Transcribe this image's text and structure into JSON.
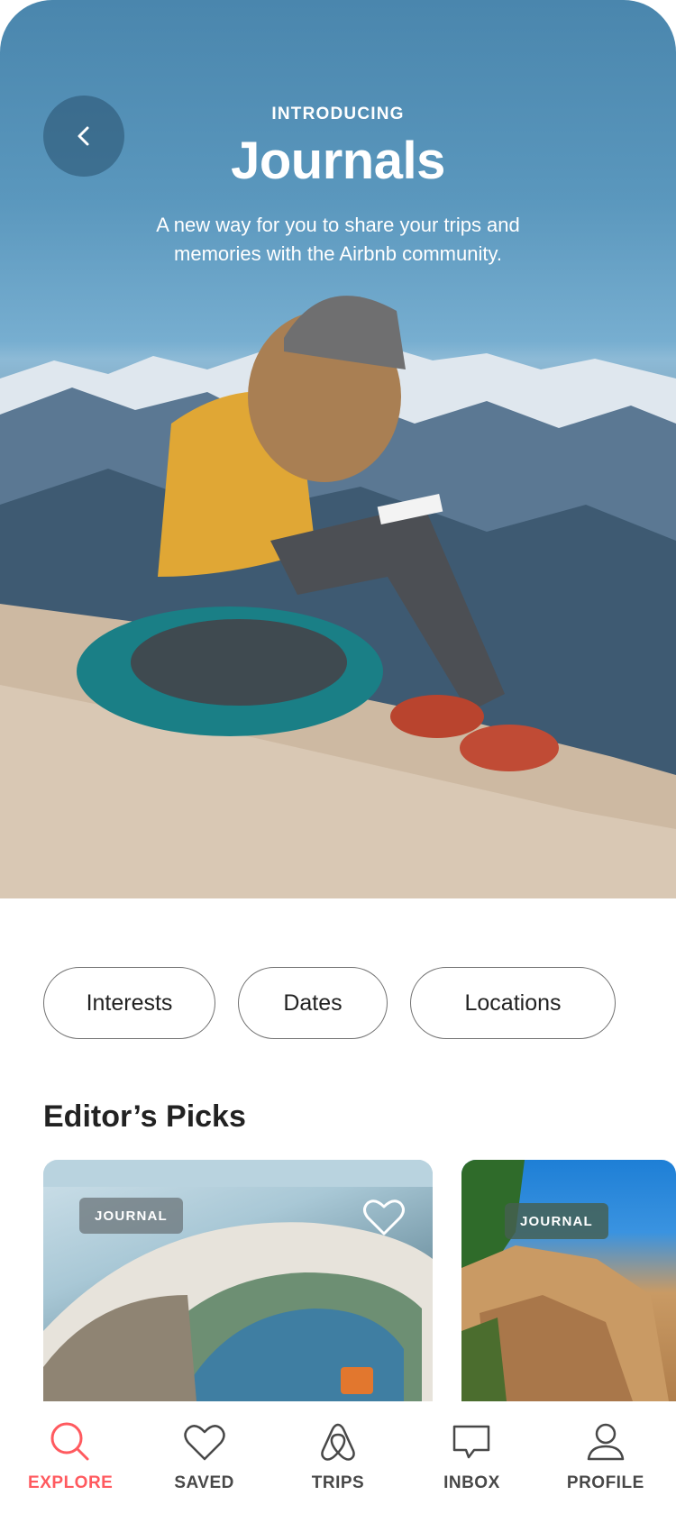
{
  "hero": {
    "eyebrow": "INTRODUCING",
    "title": "Journals",
    "subtitle": "A new way for you to share your trips and memories with the Airbnb community.",
    "back_icon": "chevron-left-icon"
  },
  "filters": [
    {
      "label": "Interests"
    },
    {
      "label": "Dates"
    },
    {
      "label": "Locations"
    }
  ],
  "editors_picks": {
    "title": "Editor’s Picks",
    "cards": [
      {
        "badge": "JOURNAL",
        "heart_icon": "heart-outline-icon"
      },
      {
        "badge": "JOURNAL"
      }
    ]
  },
  "tabbar": {
    "items": [
      {
        "label": "EXPLORE",
        "icon": "search-icon",
        "active": true
      },
      {
        "label": "SAVED",
        "icon": "heart-icon",
        "active": false
      },
      {
        "label": "TRIPS",
        "icon": "airbnb-logo-icon",
        "active": false
      },
      {
        "label": "INBOX",
        "icon": "chat-bubble-icon",
        "active": false
      },
      {
        "label": "PROFILE",
        "icon": "person-icon",
        "active": false
      }
    ]
  },
  "colors": {
    "brand": "#ff5a5f",
    "text": "#222222",
    "tab_inactive": "#484848",
    "chip_border": "#717171"
  }
}
